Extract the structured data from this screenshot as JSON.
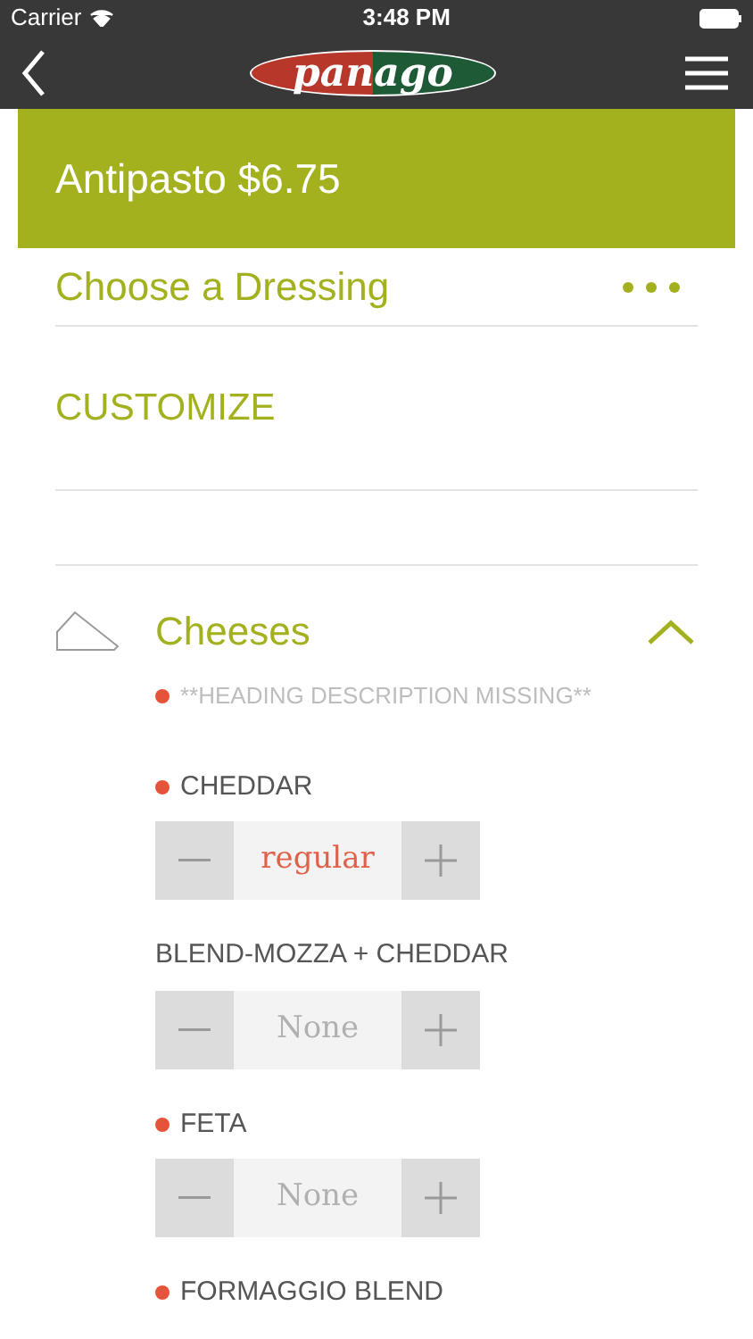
{
  "status_bar": {
    "carrier": "Carrier",
    "time": "3:48 PM"
  },
  "nav": {
    "logo": "panago"
  },
  "banner": {
    "title": "Antipasto $6.75"
  },
  "dressing": {
    "label": "Choose a Dressing"
  },
  "customize": {
    "label": "CUSTOMIZE"
  },
  "section": {
    "title": "Cheeses",
    "expanded": true,
    "description": "**HEADING DESCRIPTION MISSING**",
    "description_dot": true
  },
  "ingredients": [
    {
      "name": "CHEDDAR",
      "dot": true,
      "value": "regular",
      "added": true
    },
    {
      "name": "BLEND-MOZZA + CHEDDAR",
      "dot": false,
      "value": "None",
      "added": false
    },
    {
      "name": "FETA",
      "dot": true,
      "value": "None",
      "added": false
    },
    {
      "name": "FORMAGGIO BLEND",
      "dot": true
    }
  ]
}
